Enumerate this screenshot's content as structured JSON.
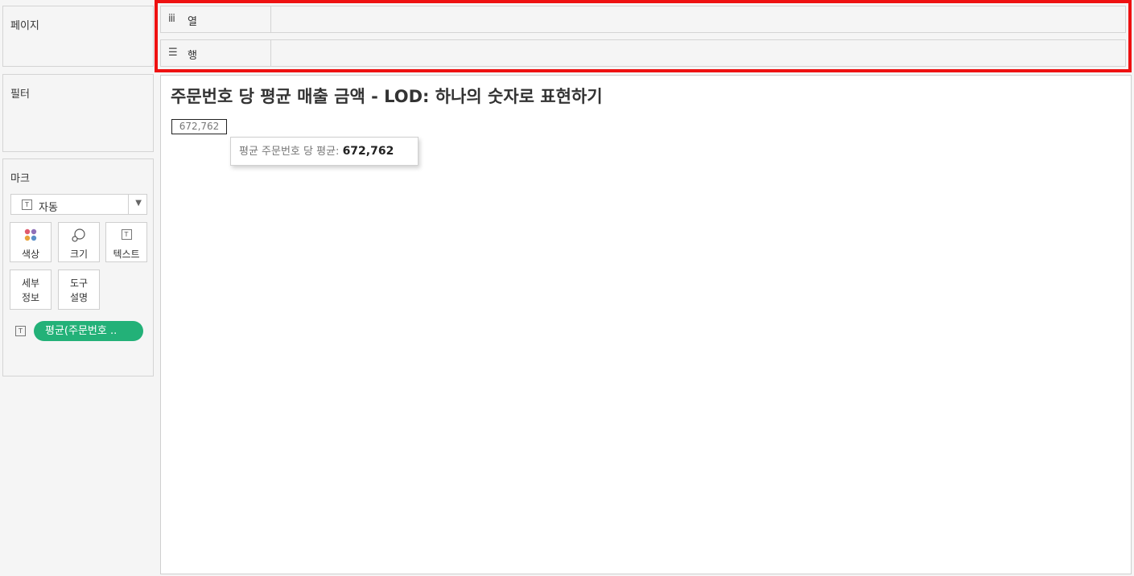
{
  "cards": {
    "pages": {
      "title": "페이지"
    },
    "filters": {
      "title": "필터"
    },
    "marks": {
      "title": "마크",
      "mark_type": "자동",
      "buttons": {
        "color": "색상",
        "size": "크기",
        "text": "텍스트",
        "detail": "세부\n정보",
        "tooltip": "도구\n설명"
      },
      "pill_label": "평균(주문번호 ..",
      "pill_color": "#23b178"
    }
  },
  "shelves": {
    "columns": {
      "icon": "iii",
      "label": "열"
    },
    "rows": {
      "icon": "☰",
      "label": "행"
    }
  },
  "view": {
    "title": "주문번호 당 평균 매출 금액 - LOD: 하나의 숫자로 표현하기",
    "value": "672,762",
    "tooltip": {
      "label": "평균 주문번호 당 평균:",
      "value": "672,762"
    }
  },
  "highlight_color": "#ee1111"
}
